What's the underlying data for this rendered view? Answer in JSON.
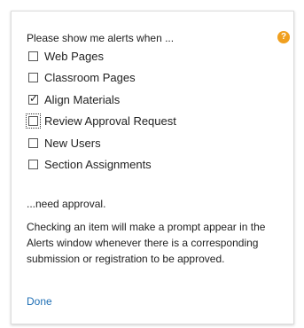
{
  "header": {
    "text": "Please show me alerts when ...",
    "help_icon": "question-icon",
    "help_glyph": "?",
    "help_color": "#f0a020"
  },
  "options": [
    {
      "label": "Web Pages",
      "checked": false,
      "focused": false
    },
    {
      "label": "Classroom Pages",
      "checked": false,
      "focused": false
    },
    {
      "label": "Align Materials",
      "checked": true,
      "focused": false
    },
    {
      "label": "Review Approval Request",
      "checked": false,
      "focused": true
    },
    {
      "label": "New Users",
      "checked": false,
      "focused": false
    },
    {
      "label": "Section Assignments",
      "checked": false,
      "focused": false
    }
  ],
  "footer": {
    "need_text": "...need approval.",
    "description": "Checking an item will make a prompt appear in the Alerts window whenever there is a corresponding submission or registration to be approved.",
    "done_label": "Done",
    "link_color": "#1f6fb5"
  }
}
